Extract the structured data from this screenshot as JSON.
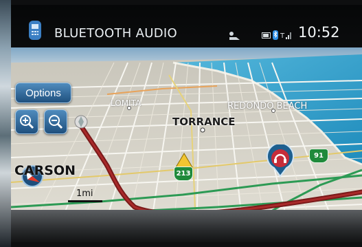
{
  "header": {
    "title": "BLUETOOTH AUDIO",
    "time": "10:52"
  },
  "map": {
    "options_label": "Options",
    "zoom_in_icon": "zoom-in-icon",
    "zoom_out_icon": "zoom-out-icon",
    "scale_label": "1mi",
    "places": {
      "lomita": "LOMITA",
      "redondo": "REDONDO BEACH",
      "torrance": "TORRANCE",
      "carson": "CARSON"
    },
    "shields": {
      "a": "213",
      "b": "91"
    }
  },
  "colors": {
    "ocean": "#2a9fc8",
    "land": "#d6d3c8",
    "route": "#8b1c1c",
    "button": "#2f6ca0"
  }
}
